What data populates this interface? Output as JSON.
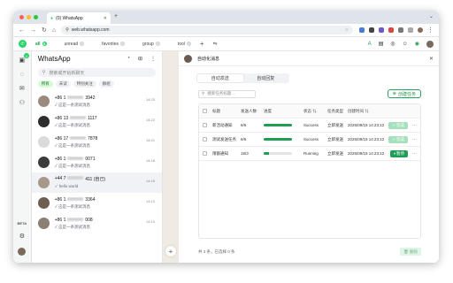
{
  "browser": {
    "tab_title": "(0) WhatsApp",
    "url": "web.whatsapp.com"
  },
  "wa_tabs": [
    {
      "label": "all",
      "count": "5",
      "active": true
    },
    {
      "label": "unread",
      "count": "0"
    },
    {
      "label": "favorites",
      "count": "0"
    },
    {
      "label": "group",
      "count": "0"
    },
    {
      "label": "tool",
      "count": "0"
    }
  ],
  "rail": {
    "badge": "3",
    "beta": "BETA"
  },
  "chatlist": {
    "title": "WhatsApp",
    "search_placeholder": "搜索或开始新聊天",
    "filters": [
      "所有",
      "未读",
      "特别关注",
      "群组"
    ]
  },
  "chats": [
    {
      "name_prefix": "+86 1",
      "name_suffix": "3942",
      "preview": "✓ 这是一条测试消息",
      "time": "14:23",
      "avatar": "#9a8b7e"
    },
    {
      "name_prefix": "+86 13",
      "name_suffix": "1117",
      "preview": "✓ 这是一条测试消息",
      "time": "14:22",
      "avatar": "#2e2e2e"
    },
    {
      "name_prefix": "+86 17",
      "name_suffix": "7878",
      "preview": "✓ 这是一条测试消息",
      "time": "14:21",
      "avatar": "#dadada"
    },
    {
      "name_prefix": "+86 1",
      "name_suffix": "0071",
      "preview": "✓ 这是一条测试消息",
      "time": "14:18",
      "avatar": "#3b3b3b"
    },
    {
      "name_prefix": "+44 7",
      "name_suffix": "411 (自己)",
      "preview": "✓ hello world",
      "time": "14:16",
      "avatar": "#a8988a",
      "selected": true
    },
    {
      "name_prefix": "+86 1",
      "name_suffix": "3364",
      "preview": "✓ 这是一条测试消息",
      "time": "14:13",
      "avatar": "#6e5e52"
    },
    {
      "name_prefix": "+86 1",
      "name_suffix": "008",
      "preview": "✓ 这是一条测试消息",
      "time": "14:13",
      "avatar": "#8c7f74"
    }
  ],
  "panel": {
    "title": "自动化消息",
    "tabs": [
      "自动发送",
      "自动回复"
    ],
    "search_placeholder": "搜索任务标题...",
    "create_label": "创建任务",
    "headers": [
      "标题",
      "发送人数",
      "进度",
      "状态",
      "任务类型",
      "创建时间"
    ],
    "rows": [
      {
        "title": "新活动通知",
        "count": "6/6",
        "progress": 1.0,
        "status": "Success",
        "type": "立即发送",
        "created": "2025/09/19 14:23:12",
        "action": "完成",
        "action_kind": "done"
      },
      {
        "title": "测试发送任务",
        "count": "6/6",
        "progress": 1.0,
        "status": "Success",
        "type": "立即发送",
        "created": "2025/09/19 14:23:12",
        "action": "完成",
        "action_kind": "done"
      },
      {
        "title": "限额通知",
        "count": "18/3",
        "progress": 0.18,
        "status": "Running",
        "type": "立即发送",
        "created": "2025/09/19 14:23:12",
        "action": "暂停",
        "action_kind": "pause"
      }
    ],
    "footer": "共 3 条，已选择 0 条",
    "delete_label": "删除"
  }
}
